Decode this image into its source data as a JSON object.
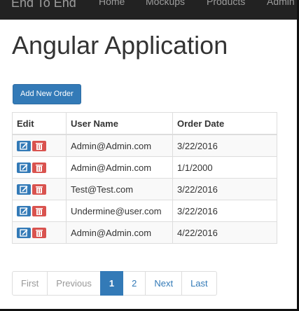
{
  "navbar": {
    "brand": "End To End",
    "links": [
      "Home",
      "Mockups",
      "Products",
      "Admin"
    ]
  },
  "page": {
    "title": "Angular Application",
    "add_button": "Add New Order"
  },
  "table": {
    "columns": [
      "Edit",
      "User Name",
      "Order Date"
    ],
    "rows": [
      {
        "user": "Admin@Admin.com",
        "date": "3/22/2016"
      },
      {
        "user": "Admin@Admin.com",
        "date": "1/1/2000"
      },
      {
        "user": "Test@Test.com",
        "date": "3/22/2016"
      },
      {
        "user": "Undermine@user.com",
        "date": "3/22/2016"
      },
      {
        "user": "Admin@Admin.com",
        "date": "4/22/2016"
      }
    ],
    "icons": {
      "edit": "edit-icon",
      "delete": "trash-icon"
    }
  },
  "pagination": {
    "first": "First",
    "previous": "Previous",
    "pages": [
      "1",
      "2"
    ],
    "current": "1",
    "next": "Next",
    "last": "Last"
  },
  "colors": {
    "primary": "#337ab7",
    "danger": "#d9534f",
    "navbar": "#222222"
  }
}
